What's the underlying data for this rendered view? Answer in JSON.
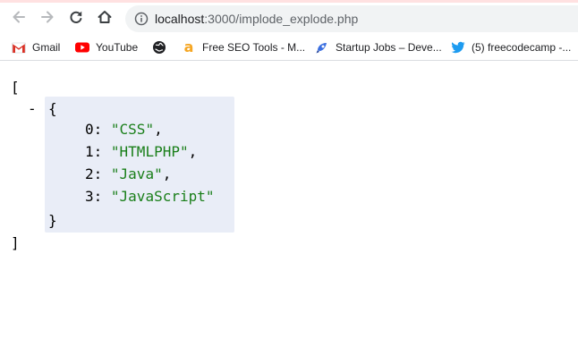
{
  "browser": {
    "nav": {
      "back_icon": "arrow-left-icon",
      "forward_icon": "arrow-right-icon",
      "reload_icon": "reload-icon",
      "home_icon": "home-icon"
    },
    "address_bar": {
      "host": "localhost",
      "path": ":3000/implode_explode.php",
      "icon": "info-icon"
    },
    "bookmarks": [
      {
        "label": "Gmail",
        "icon": "gmail-icon"
      },
      {
        "label": "YouTube",
        "icon": "youtube-icon"
      },
      {
        "label": "",
        "icon": "globe-icon"
      },
      {
        "label": "Free SEO Tools - M...",
        "icon": "seo-tools-icon"
      },
      {
        "label": "Startup Jobs – Deve...",
        "icon": "startup-jobs-icon"
      },
      {
        "label": "(5) freecodecamp -...",
        "icon": "twitter-icon"
      }
    ]
  },
  "json_view": {
    "open_bracket": "[",
    "close_bracket": "]",
    "collapse_toggle": "-",
    "open_brace": "{",
    "close_brace": "}",
    "entries": [
      {
        "key": "0",
        "value": "\"CSS\"",
        "sep": ","
      },
      {
        "key": "1",
        "value": "\"HTMLPHP\"",
        "sep": ","
      },
      {
        "key": "2",
        "value": "\"Java\"",
        "sep": ","
      },
      {
        "key": "3",
        "value": "\"JavaScript\"",
        "sep": ""
      }
    ],
    "colors": {
      "string": "#1a7f1a",
      "highlight": "#e9edf7"
    }
  }
}
